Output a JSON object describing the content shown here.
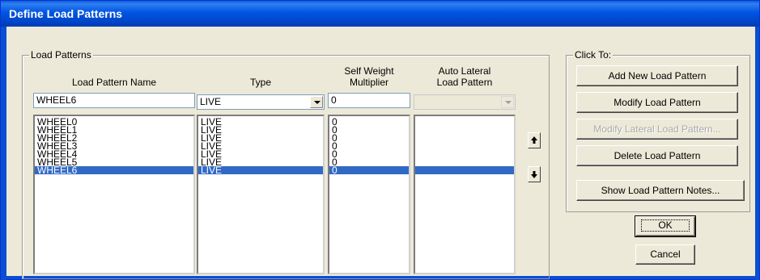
{
  "window": {
    "title": "Define Load Patterns"
  },
  "load_patterns": {
    "group_label": "Load Patterns",
    "columns": {
      "name": "Load Pattern Name",
      "type": "Type",
      "self_weight": [
        "Self Weight",
        "Multiplier"
      ],
      "auto_lateral": [
        "Auto Lateral",
        "Load Pattern"
      ]
    },
    "edit_row": {
      "name": "WHEEL6",
      "type": "LIVE",
      "self_weight": "0",
      "auto_lateral": ""
    },
    "rows": [
      {
        "name": "WHEEL0",
        "type": "LIVE",
        "multiplier": "0"
      },
      {
        "name": "WHEEL1",
        "type": "LIVE",
        "multiplier": "0"
      },
      {
        "name": "WHEEL2",
        "type": "LIVE",
        "multiplier": "0"
      },
      {
        "name": "WHEEL3",
        "type": "LIVE",
        "multiplier": "0"
      },
      {
        "name": "WHEEL4",
        "type": "LIVE",
        "multiplier": "0"
      },
      {
        "name": "WHEEL5",
        "type": "LIVE",
        "multiplier": "0"
      },
      {
        "name": "WHEEL6",
        "type": "LIVE",
        "multiplier": "0"
      }
    ],
    "selected_row": "WHEEL6"
  },
  "click_to": {
    "group_label": "Click To:",
    "buttons": {
      "add": "Add New Load Pattern",
      "modify": "Modify Load Pattern",
      "modify_lateral": "Modify Lateral Load Pattern...",
      "delete": "Delete Load Pattern",
      "notes": "Show Load Pattern Notes..."
    }
  },
  "dialog_buttons": {
    "ok": "OK",
    "cancel": "Cancel"
  },
  "icons": {
    "move_up": "arrow-up-icon",
    "move_down": "arrow-down-icon",
    "dropdown": "chevron-down-icon"
  },
  "colors": {
    "titlebar": "#0054e3",
    "selection": "#316ac5",
    "dialog_bg": "#ece9d8"
  }
}
